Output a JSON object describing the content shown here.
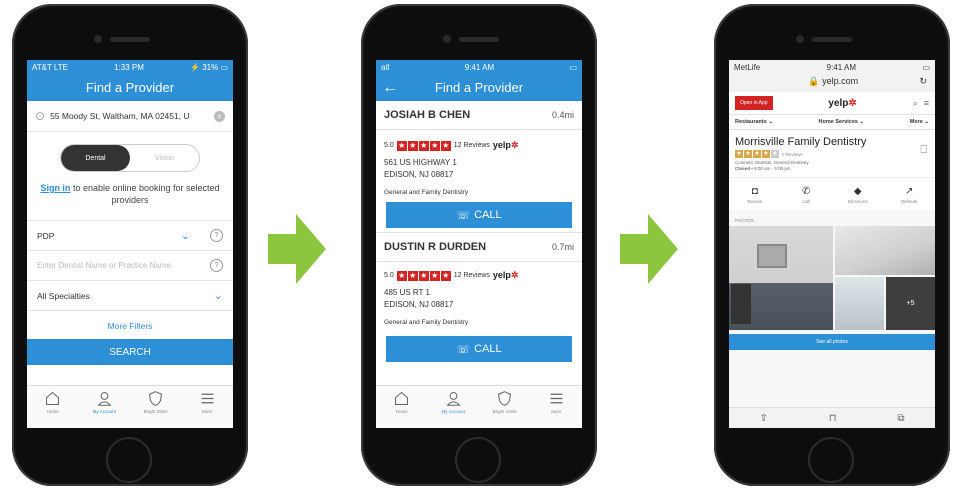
{
  "phone1": {
    "status": {
      "carrier": "AT&T  LTE",
      "time": "1:33 PM",
      "battery": "31%"
    },
    "title": "Find a Provider",
    "address": "55 Moody St, Waltham, MA 02451, U",
    "toggle": {
      "active": "Dental",
      "inactive": "Vision"
    },
    "signin_link": "Sign in",
    "signin_text": " to enable online booking for selected providers",
    "plan": "PDP",
    "dentist_placeholder": "Enter Dentist Name or Practice Name",
    "specialties": "All Specialties",
    "more_filters": "More Filters",
    "search": "SEARCH",
    "tabs": [
      "Home",
      "My Account",
      "Bright Smile",
      "More"
    ]
  },
  "phone2": {
    "status": {
      "signal": "atl",
      "time": "9:41 AM"
    },
    "title": "Find a Provider",
    "providers": [
      {
        "name": "JOSIAH B CHEN",
        "distance": "0.4mi",
        "rating": "5.0",
        "reviews": "12 Reviews",
        "address1": "561 US HIGHWAY 1",
        "address2": "EDISON, NJ 08817",
        "specialty": "General and Family Dentistry",
        "call": "CALL"
      },
      {
        "name": "DUSTIN R DURDEN",
        "distance": "0.7mi",
        "rating": "5.0",
        "reviews": "12 Reviews",
        "address1": "485 US RT 1",
        "address2": "EDISON, NJ 08817",
        "specialty": "General and Family Dentistry",
        "call": "CALL"
      }
    ],
    "yelp": "yelp",
    "tabs": [
      "Home",
      "My Account",
      "Bright Smile",
      "More"
    ]
  },
  "phone3": {
    "status": {
      "carrier": "MetLife",
      "time": "9:41 AM"
    },
    "url": "yelp.com",
    "open_in_app": "Open in App",
    "yelp_logo": "yelp",
    "nav": [
      "Restaurants",
      "Home Services",
      "More"
    ],
    "business_name": "Morrisville Family Dentistry",
    "reviews": "0 Reviews",
    "categories": "Cosmetic Dentists, General Dentistry",
    "hours_status": "Closed",
    "hours": "8:00 am - 5:00 pm",
    "actions": [
      "Review",
      "Call",
      "Directions",
      "Website"
    ],
    "photos_label": "PHOTOS",
    "photo_count": "+5",
    "see_all": "See all photos"
  },
  "colors": {
    "brand_blue": "#2d8fd6",
    "yelp_red": "#d32323",
    "arrow_green": "#8cc63f"
  }
}
